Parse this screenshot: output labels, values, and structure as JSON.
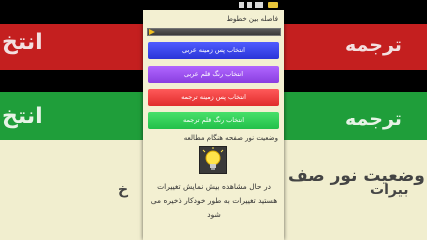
{
  "background": {
    "heading_1": "انتخ",
    "heading_1_right": "ترجمه",
    "heading_2": "انتخ",
    "heading_2_right": "ترجمه",
    "light_status_partial": "وضعیت نور صف",
    "desc_right": "بیرات",
    "desc_left": "خ",
    "colors": {
      "red": "#c82020",
      "green": "#1ea43a",
      "cream": "#f2efcf"
    }
  },
  "settings": {
    "line_spacing_label": "فاصله بین خطوط",
    "buttons": [
      {
        "label": "انتخاب پس زمینه عربی",
        "color": "#3a44f0"
      },
      {
        "label": "انتخاب رنگ قلم عربی",
        "color": "#9a4ff0"
      },
      {
        "label": "انتخاب پس زمینه ترجمه",
        "color": "#f04040"
      },
      {
        "label": "انتخاب رنگ قلم ترجمه",
        "color": "#34d058"
      }
    ],
    "light_status_label": "وضعیت نور صفحه هنگام مطالعه",
    "lamp_icon": "lightbulb-on-icon",
    "description": "در حال مشاهده بیش نمایش تغییرات هستید تغییرات به طور خودکار ذخیره می شود"
  }
}
